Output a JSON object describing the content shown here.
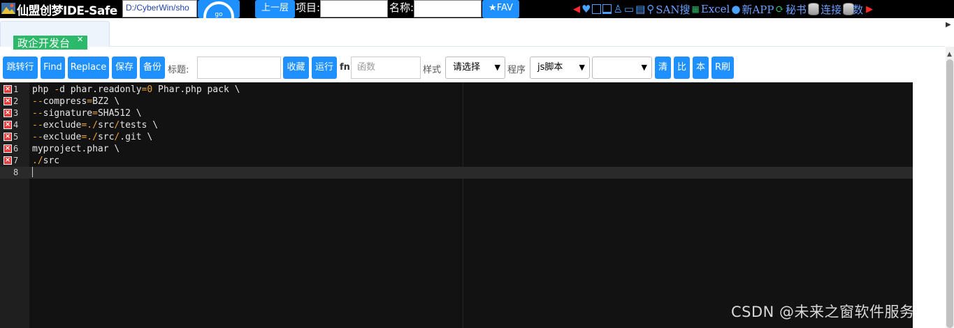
{
  "topbar": {
    "app_title": "仙盟创梦IDE-Safe",
    "path_value": "D:/CyberWin/sho",
    "gauge_text": "go",
    "up_button": "上一层",
    "project_label": "项目:",
    "project_value": "",
    "name_label": "名称:",
    "name_value": "",
    "fav_button": "★FAV",
    "icons": [
      "left-arrow-icon",
      "heart-icon",
      "window-icon",
      "window-icon",
      "user-icon",
      "folder-icon",
      "calc-icon",
      "search-icon"
    ],
    "links": {
      "san": "SAN搜",
      "excel": "Excel",
      "newapp": "新APP",
      "secretary": "秘书",
      "connect": "连接",
      "data": "数"
    }
  },
  "tabs": [
    {
      "label": "政企开发台",
      "active": true
    }
  ],
  "toolbar": {
    "goto_line": "跳转行",
    "find": "Find",
    "replace": "Replace",
    "save": "保存",
    "backup": "备份",
    "title_label": "标题:",
    "title_value": "",
    "favorite": "收藏",
    "run": "运行",
    "fn_label": "fn",
    "fn_placeholder": "函数",
    "style_label": "样式",
    "style_selected": "请选择",
    "program_label": "程序",
    "program_selected": "js脚本",
    "extra_selected": "",
    "clear": "清",
    "compare": "比",
    "local": "本",
    "refresh": "R刷"
  },
  "editor": {
    "lines": [
      {
        "num": "1",
        "error": true,
        "tokens": [
          [
            "plain",
            "php "
          ],
          [
            "op",
            "-"
          ],
          [
            "plain",
            "d phar.readonly"
          ],
          [
            "op",
            "="
          ],
          [
            "num",
            "0"
          ],
          [
            "plain",
            " Phar.php pack \\"
          ]
        ]
      },
      {
        "num": "2",
        "error": true,
        "tokens": [
          [
            "op",
            "--"
          ],
          [
            "plain",
            "compress"
          ],
          [
            "op",
            "="
          ],
          [
            "plain",
            "BZ2 \\"
          ]
        ]
      },
      {
        "num": "3",
        "error": true,
        "tokens": [
          [
            "op",
            "--"
          ],
          [
            "plain",
            "signature"
          ],
          [
            "op",
            "="
          ],
          [
            "plain",
            "SHA512 \\"
          ]
        ]
      },
      {
        "num": "4",
        "error": true,
        "tokens": [
          [
            "op",
            "--"
          ],
          [
            "plain",
            "exclude"
          ],
          [
            "op",
            "=./"
          ],
          [
            "plain",
            "src"
          ],
          [
            "op",
            "/"
          ],
          [
            "plain",
            "tests \\"
          ]
        ]
      },
      {
        "num": "5",
        "error": true,
        "tokens": [
          [
            "op",
            "--"
          ],
          [
            "plain",
            "exclude"
          ],
          [
            "op",
            "=./"
          ],
          [
            "plain",
            "src"
          ],
          [
            "op",
            "/"
          ],
          [
            "plain",
            ".git \\"
          ]
        ]
      },
      {
        "num": "6",
        "error": true,
        "tokens": [
          [
            "plain",
            "myproject.phar \\"
          ]
        ]
      },
      {
        "num": "7",
        "error": true,
        "tokens": [
          [
            "op",
            "./"
          ],
          [
            "plain",
            "src"
          ]
        ]
      },
      {
        "num": "8",
        "error": false,
        "tokens": []
      }
    ],
    "active_line": 8
  },
  "watermark": "CSDN @未来之窗软件服务"
}
